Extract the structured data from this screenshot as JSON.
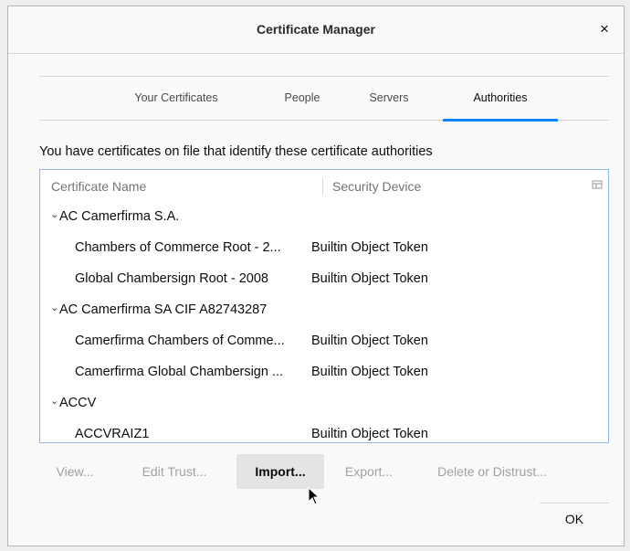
{
  "dialog": {
    "title": "Certificate Manager",
    "close_glyph": "×"
  },
  "tabs": [
    {
      "label": "Your Certificates",
      "selected": false
    },
    {
      "label": "People",
      "selected": false
    },
    {
      "label": "Servers",
      "selected": false
    },
    {
      "label": "Authorities",
      "selected": true
    }
  ],
  "intro_text": "You have certificates on file that identify these certificate authorities",
  "table": {
    "columns": [
      "Certificate Name",
      "Security Device"
    ],
    "column_picker_icon": "column-picker-icon",
    "rows": [
      {
        "type": "group",
        "twisty": "⌄",
        "name": "AC Camerfirma S.A."
      },
      {
        "type": "cert",
        "name": "Chambers of Commerce Root - 2...",
        "device": "Builtin Object Token"
      },
      {
        "type": "cert",
        "name": "Global Chambersign Root - 2008",
        "device": "Builtin Object Token"
      },
      {
        "type": "group",
        "twisty": "⌄",
        "name": "AC Camerfirma SA CIF A82743287"
      },
      {
        "type": "cert",
        "name": "Camerfirma Chambers of Comme...",
        "device": "Builtin Object Token"
      },
      {
        "type": "cert",
        "name": "Camerfirma Global Chambersign ...",
        "device": "Builtin Object Token"
      },
      {
        "type": "group",
        "twisty": "⌄",
        "name": "ACCV"
      },
      {
        "type": "cert",
        "name": "ACCVRAIZ1",
        "device": "Builtin Object Token"
      }
    ]
  },
  "buttons": {
    "view": "View...",
    "edit_trust": "Edit Trust...",
    "import": "Import...",
    "export": "Export...",
    "delete": "Delete or Distrust...",
    "ok": "OK"
  },
  "colors": {
    "accent": "#0a84ff",
    "tree_border": "#8fb8e8"
  }
}
